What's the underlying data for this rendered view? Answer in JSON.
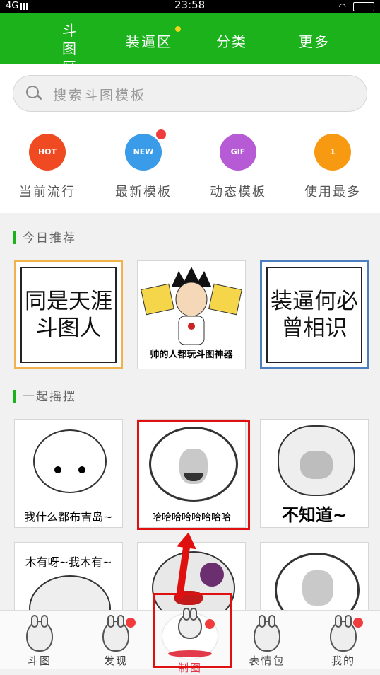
{
  "statusbar": {
    "network": "4G",
    "time": "23:58"
  },
  "topnav": {
    "tabs": [
      {
        "label": "斗图区",
        "active": true
      },
      {
        "label": "装逼区",
        "badge": true
      },
      {
        "label": "分类"
      },
      {
        "label": "更多"
      }
    ]
  },
  "search": {
    "placeholder": "搜索斗图模板"
  },
  "categories": [
    {
      "label": "当前流行",
      "icon": "hot-icon",
      "badge_text": "HOT",
      "color": "#f04a22"
    },
    {
      "label": "最新模板",
      "icon": "new-icon",
      "badge_text": "NEW",
      "color": "#3a9be8",
      "dot": true
    },
    {
      "label": "动态模板",
      "icon": "gif-icon",
      "badge_text": "GIF",
      "color": "#b65ad6"
    },
    {
      "label": "使用最多",
      "icon": "trophy-icon",
      "badge_text": "1",
      "color": "#f79a12"
    }
  ],
  "section_today": {
    "title": "今日推荐"
  },
  "today_cards": [
    {
      "text": "同是天涯斗图人",
      "border_color": "#f0b24a"
    },
    {
      "caption": "帅的人都玩斗图神器"
    },
    {
      "text": "装逼何必曾相识",
      "border_color": "#4b7fc0"
    }
  ],
  "section_together": {
    "title": "一起摇摆"
  },
  "grid_cards": [
    {
      "caption": "我什么都布吉岛~"
    },
    {
      "caption": "哈哈哈哈哈哈哈哈"
    },
    {
      "caption": "不知道~"
    },
    {
      "caption": "木有呀~我木有~"
    },
    {
      "caption": ""
    },
    {
      "caption": ""
    }
  ],
  "bottomnav": [
    {
      "label": "斗图"
    },
    {
      "label": "发现",
      "dot": true
    },
    {
      "label": "制图",
      "active": true,
      "dot": true
    },
    {
      "label": "表情包"
    },
    {
      "label": "我的",
      "dot": true
    }
  ],
  "colors": {
    "brand": "#1cb21c",
    "highlight": "#e01010"
  }
}
